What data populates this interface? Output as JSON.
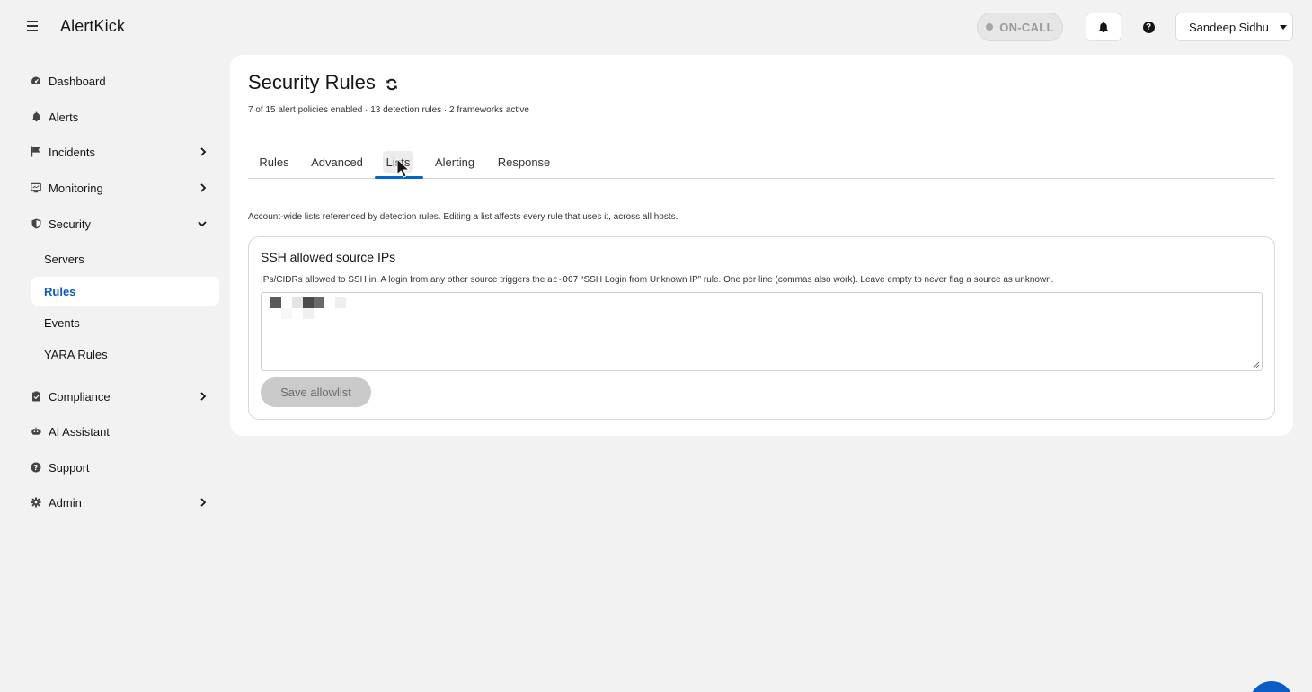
{
  "header": {
    "brand": "AlertKick",
    "oncall_label": "ON-CALL",
    "user_name": "Sandeep Sidhu"
  },
  "sidebar": {
    "items": [
      {
        "label": "Dashboard",
        "icon": "dashboard-icon"
      },
      {
        "label": "Alerts",
        "icon": "bell-icon"
      },
      {
        "label": "Incidents",
        "icon": "flag-icon"
      },
      {
        "label": "Monitoring",
        "icon": "monitor-icon"
      },
      {
        "label": "Security",
        "icon": "shield-icon"
      },
      {
        "label": "Compliance",
        "icon": "clipboard-icon"
      },
      {
        "label": "AI Assistant",
        "icon": "robot-icon"
      },
      {
        "label": "Support",
        "icon": "help-circle-icon"
      },
      {
        "label": "Admin",
        "icon": "gear-icon"
      }
    ],
    "security_subitems": [
      "Servers",
      "Rules",
      "Events",
      "YARA Rules"
    ],
    "active_subitem": "Rules"
  },
  "main": {
    "title": "Security Rules",
    "summary": "7 of 15 alert policies enabled · 13 detection rules · 2 frameworks active",
    "tabs": [
      "Rules",
      "Advanced",
      "Lists",
      "Alerting",
      "Response"
    ],
    "active_tab": "Lists",
    "description": "Account-wide lists referenced by detection rules. Editing a list affects every rule that uses it, across all hosts.",
    "panel": {
      "title": "SSH allowed source IPs",
      "help_prefix": "IPs/CIDRs allowed to SSH in. A login from any other source triggers the",
      "help_code": "ac-007",
      "help_suffix": "“SSH Login from Unknown IP” rule. One per line (commas also work). Leave empty to never flag a source as unknown.",
      "save_label": "Save allowlist"
    }
  },
  "colors": {
    "accent": "#0066cc",
    "active_nav_text": "#0b5cb8",
    "background": "#f2f2f2",
    "card": "#ffffff"
  }
}
